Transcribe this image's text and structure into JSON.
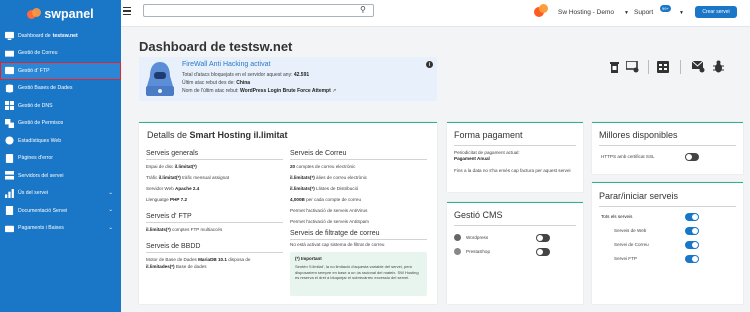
{
  "brand": {
    "name": "swpanel"
  },
  "sidebar": {
    "items": [
      {
        "label": "Dashboard de ",
        "bold": "testsw.net",
        "chevron": ""
      },
      {
        "label": "Gestió de Correu",
        "bold": "",
        "chevron": ""
      },
      {
        "label": "Gestió d' FTP",
        "bold": "",
        "chevron": ""
      },
      {
        "label": "Gestió Bases de Dades",
        "bold": "",
        "chevron": ""
      },
      {
        "label": "Gestió de DNS",
        "bold": "",
        "chevron": ""
      },
      {
        "label": "Gestió de Permisos",
        "bold": "",
        "chevron": ""
      },
      {
        "label": "Estadístiques Web",
        "bold": "",
        "chevron": ""
      },
      {
        "label": "Pàgines d'error",
        "bold": "",
        "chevron": ""
      },
      {
        "label": "Servidors del servei",
        "bold": "",
        "chevron": ""
      },
      {
        "label": "Ús del servei",
        "bold": "",
        "chevron": "⌄"
      },
      {
        "label": "Documentació Servei",
        "bold": "",
        "chevron": "⌄"
      },
      {
        "label": "Pagaments i Baixes",
        "bold": "",
        "chevron": "⌄"
      }
    ]
  },
  "topbar": {
    "account": "Sw Hosting - Demo",
    "support": "Suport",
    "support_badge": "99+",
    "create_button": "Crear servei",
    "search_value": ""
  },
  "page": {
    "title_prefix": "Dashboard de ",
    "title_domain": "testsw.net"
  },
  "firewall": {
    "title": "FireWall Anti Hacking activat",
    "line1_label": "Total d'atacs bloquejats en el servidor aquest any:",
    "line1_value": "42.591",
    "line2_label": "Últim atac rebut des de:",
    "line2_value": "China",
    "line3_label": "Nom de l'últim atac rebut:",
    "line3_value": "WordPress Login Brute Force Attempt"
  },
  "details": {
    "title_prefix": "Detalls de ",
    "title_bold": "Smart Hosting il.limitat",
    "general": {
      "heading": "Serveis generals",
      "rows": [
        {
          "label": "Espai de disc ",
          "value": "il.limitat(*)"
        },
        {
          "label": "Tràfic ",
          "value": "il.limitat(*)",
          "suffix": " tràfic mensual assignat"
        },
        {
          "label": "Servidor Web ",
          "value": "Apache 2.4"
        },
        {
          "label": "Llenguatge ",
          "value": "PHP 7.2"
        }
      ]
    },
    "ftp": {
      "heading": "Serveis d' FTP",
      "row_value": "il.limitats(*)",
      "row_suffix": " comptes FTP multiaccés"
    },
    "bbdd": {
      "heading": "Serveis de BBDD",
      "line1": "Motor de Base de Dades ",
      "line1_value": "MariaDB 10.1",
      "line1_suffix": " disposa de",
      "line2_value": "il.limitades(*)",
      "line2_suffix": " Base de dades"
    },
    "mail": {
      "heading": "Serveis de Correu",
      "rows": [
        {
          "value": "20",
          "suffix": " comptes de correu electrònic"
        },
        {
          "value": "il.limitats(*)",
          "suffix": " àlies de correu electrònic"
        },
        {
          "value": "il.limitats(*)",
          "suffix": " Llistes de Distribució"
        },
        {
          "value": "4,000B",
          "suffix": " per cada compte de correu"
        },
        {
          "value": "",
          "suffix": "Permet l'activació de serveis AntiVirus"
        },
        {
          "value": "",
          "suffix": "Permet l'activació de serveis AntiSpam"
        }
      ]
    },
    "filter": {
      "heading": "Serveis de filtratge de correu",
      "text": "No està activat cap sistema de filtrat de correu"
    },
    "important": {
      "title": "(*) Important",
      "text": "Sentén 'il.limitat', la no limitació d'aquesta variable del servei, però disposaríem sempre en base a un ús racional del mateix. SW Hosting es reserva el dret a bloquejar el sobrecàrrec excessiu del servei."
    }
  },
  "payment": {
    "title": "Forma pagament",
    "line1": "Periodicitat de pagament actual:",
    "line1_value": "Pagament Anual",
    "line2": "Fins a la data no s'ha emès cap factura per aquest servei"
  },
  "cms": {
    "title": "Gestió CMS",
    "items": [
      {
        "label": "Wordpress",
        "on": false
      },
      {
        "label": "PrestaShop",
        "on": false
      }
    ]
  },
  "improvements": {
    "title": "Millores disponibles",
    "items": [
      {
        "label": "HTTPS amb certificat SSL",
        "on": false
      }
    ]
  },
  "start_stop": {
    "title": "Parar/iniciar serveis",
    "all_label": "Tots els serveis",
    "items": [
      {
        "label": "Serveis de Web",
        "on": true
      },
      {
        "label": "Servei de Correu",
        "on": true
      },
      {
        "label": "Servei FTP",
        "on": true
      }
    ]
  },
  "colors": {
    "brand_blue": "#1a76c6",
    "accent_green": "#2bb38c",
    "orange": "#ff5a1f",
    "active_outline": "#e4232a"
  },
  "icons": [
    "dashboard-icon",
    "mail-icon",
    "ftp-icon",
    "database-icon",
    "dns-icon",
    "permissions-icon",
    "stats-icon",
    "error-pages-icon",
    "servers-icon",
    "usage-icon",
    "docs-icon",
    "payments-icon",
    "search-icon",
    "hacker-icon",
    "info-icon",
    "trash-icon",
    "screen-icon",
    "calendar-icon",
    "mail-check-icon",
    "bug-icon"
  ]
}
